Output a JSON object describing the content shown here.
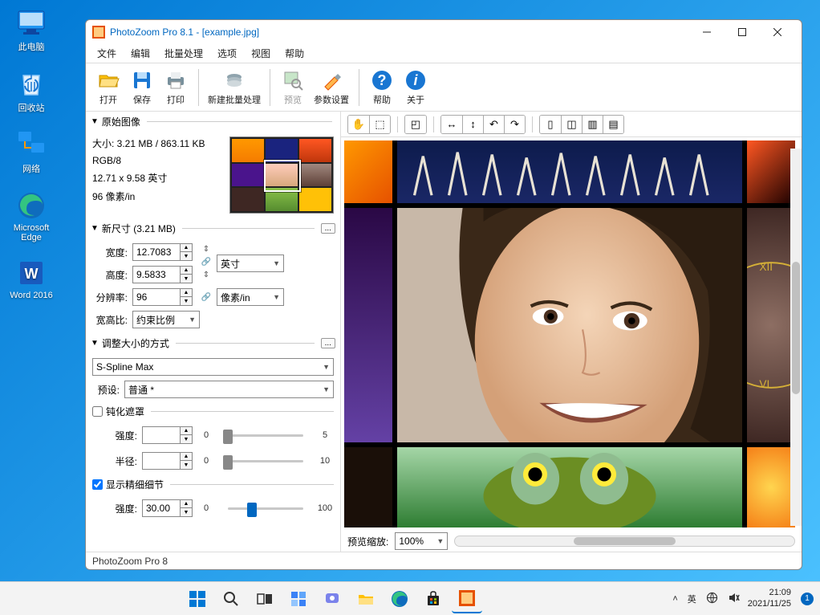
{
  "desktop": {
    "icons": [
      {
        "name": "此电脑",
        "key": "this-pc"
      },
      {
        "name": "回收站",
        "key": "recycle-bin"
      },
      {
        "name": "网络",
        "key": "network"
      },
      {
        "name": "Microsoft Edge",
        "key": "edge"
      },
      {
        "name": "Word 2016",
        "key": "word"
      }
    ]
  },
  "window": {
    "title": "PhotoZoom Pro 8.1 - [example.jpg]",
    "menu": [
      "文件",
      "编辑",
      "批量处理",
      "选项",
      "视图",
      "帮助"
    ],
    "toolbar": {
      "open": "打开",
      "save": "保存",
      "print": "打印",
      "batch": "新建批量处理",
      "preview": "预览",
      "params": "参数设置",
      "help": "帮助",
      "about": "关于"
    },
    "panel": {
      "orig_title": "原始图像",
      "orig": {
        "size": "大小: 3.21 MB / 863.11 KB",
        "mode": "RGB/8",
        "dim": "12.71 x 9.58 英寸",
        "dpi": "96 像素/in"
      },
      "newsize_title": "新尺寸 (3.21 MB)",
      "width_label": "宽度:",
      "width_val": "12.7083",
      "height_label": "高度:",
      "height_val": "9.5833",
      "unit1": "英寸",
      "res_label": "分辨率:",
      "res_val": "96",
      "unit2": "像素/in",
      "aspect_label": "宽高比:",
      "aspect_val": "约束比例",
      "method_title": "调整大小的方式",
      "method_val": "S-Spline Max",
      "preset_label": "预设:",
      "preset_val": "普通 *",
      "unsharp": "钝化遮罩",
      "intensity": "强度:",
      "radius": "半径:",
      "fine": "显示精细细节",
      "fine_val": "30.00",
      "zoom_label": "预览缩放:",
      "zoom_val": "100%"
    },
    "slider": {
      "min0": "0",
      "max5": "5",
      "max10": "10",
      "max100": "100"
    },
    "status": "PhotoZoom Pro 8"
  },
  "taskbar": {
    "lang": "英",
    "time": "21:09",
    "date": "2021/11/25",
    "badge": "1"
  }
}
